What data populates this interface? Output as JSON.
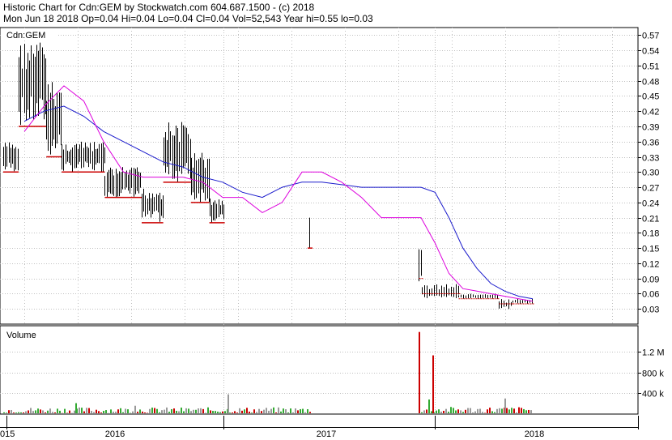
{
  "header": {
    "line1": "Historic Chart for Cdn:GEM by Stockwatch.com 604.687.1500 - (c) 2018",
    "line2": "Mon Jun 18 2018  Op=0.04  Hi=0.04  Lo=0.04  Cl=0.04  Vol=52,543  Year hi=0.55  lo=0.03"
  },
  "colors": {
    "bar": "#000000",
    "down_tick": "#cc0000",
    "ma_short": "#dd00dd",
    "ma_long": "#1a1acc",
    "vol_up": "#33aa33",
    "vol_down": "#cc0000",
    "vol_flat": "#999999",
    "grid": "#c0c0c0"
  },
  "chart_data": [
    {
      "type": "bar",
      "panel": "price",
      "title": "Cdn:GEM",
      "y_ticks": [
        "0.57",
        "0.54",
        "0.51",
        "0.48",
        "0.45",
        "0.42",
        "0.39",
        "0.36",
        "0.33",
        "0.30",
        "0.27",
        "0.24",
        "0.21",
        "0.18",
        "0.15",
        "0.12",
        "0.09",
        "0.06",
        "0.03"
      ],
      "ylim": [
        0,
        0.585
      ],
      "x_ticks": [
        "015",
        "2016",
        "2017",
        "2018"
      ],
      "grid": true,
      "segments": [
        {
          "start": 0.0,
          "end": 0.05,
          "hi": 0.36,
          "lo": 0.3,
          "close": 0.33
        },
        {
          "start": 0.05,
          "end": 0.14,
          "hi": 0.56,
          "lo": 0.39,
          "close": 0.46
        },
        {
          "start": 0.14,
          "end": 0.19,
          "hi": 0.48,
          "lo": 0.33,
          "close": 0.4
        },
        {
          "start": 0.19,
          "end": 0.33,
          "hi": 0.36,
          "lo": 0.3,
          "close": 0.31
        },
        {
          "start": 0.33,
          "end": 0.45,
          "hi": 0.31,
          "lo": 0.25,
          "close": 0.26
        },
        {
          "start": 0.45,
          "end": 0.52,
          "hi": 0.27,
          "lo": 0.2,
          "close": 0.21
        },
        {
          "start": 0.52,
          "end": 0.61,
          "hi": 0.4,
          "lo": 0.28,
          "close": 0.31
        },
        {
          "start": 0.61,
          "end": 0.67,
          "hi": 0.34,
          "lo": 0.24,
          "close": 0.26
        },
        {
          "start": 0.67,
          "end": 0.72,
          "hi": 0.25,
          "lo": 0.2,
          "close": 0.21
        }
      ],
      "final_bar": {
        "hi": 0.21,
        "lo": 0.15,
        "close": 0.15
      },
      "gap_note": "",
      "segments_2018": [
        {
          "start": 0.0,
          "end": 0.03,
          "hi": 0.15,
          "lo": 0.08,
          "close": 0.09
        },
        {
          "start": 0.03,
          "end": 0.35,
          "hi": 0.08,
          "lo": 0.05,
          "close": 0.06
        },
        {
          "start": 0.35,
          "end": 0.7,
          "hi": 0.06,
          "lo": 0.05,
          "close": 0.05
        },
        {
          "start": 0.7,
          "end": 0.82,
          "hi": 0.05,
          "lo": 0.03,
          "close": 0.04
        },
        {
          "start": 0.82,
          "end": 1.0,
          "hi": 0.05,
          "lo": 0.04,
          "close": 0.04
        }
      ],
      "ma_short": [
        0.38,
        0.43,
        0.47,
        0.44,
        0.36,
        0.3,
        0.29,
        0.29,
        0.29,
        0.28,
        0.25,
        0.25,
        0.22,
        0.24,
        0.3,
        0.3,
        0.28,
        0.25,
        0.21,
        0.21,
        0.21,
        0.16,
        0.1,
        0.07,
        0.065,
        0.06,
        0.055,
        0.05,
        0.045
      ],
      "ma_long": [
        0.4,
        0.42,
        0.43,
        0.41,
        0.38,
        0.36,
        0.34,
        0.32,
        0.31,
        0.29,
        0.28,
        0.26,
        0.25,
        0.27,
        0.28,
        0.28,
        0.275,
        0.27,
        0.27,
        0.27,
        0.27,
        0.26,
        0.21,
        0.15,
        0.11,
        0.08,
        0.065,
        0.055,
        0.05
      ]
    },
    {
      "type": "bar",
      "panel": "volume",
      "title": "Volume",
      "y_ticks": [
        "1.2 M",
        "800 k",
        "400 k"
      ],
      "ylim": [
        0,
        1700000
      ]
    }
  ]
}
